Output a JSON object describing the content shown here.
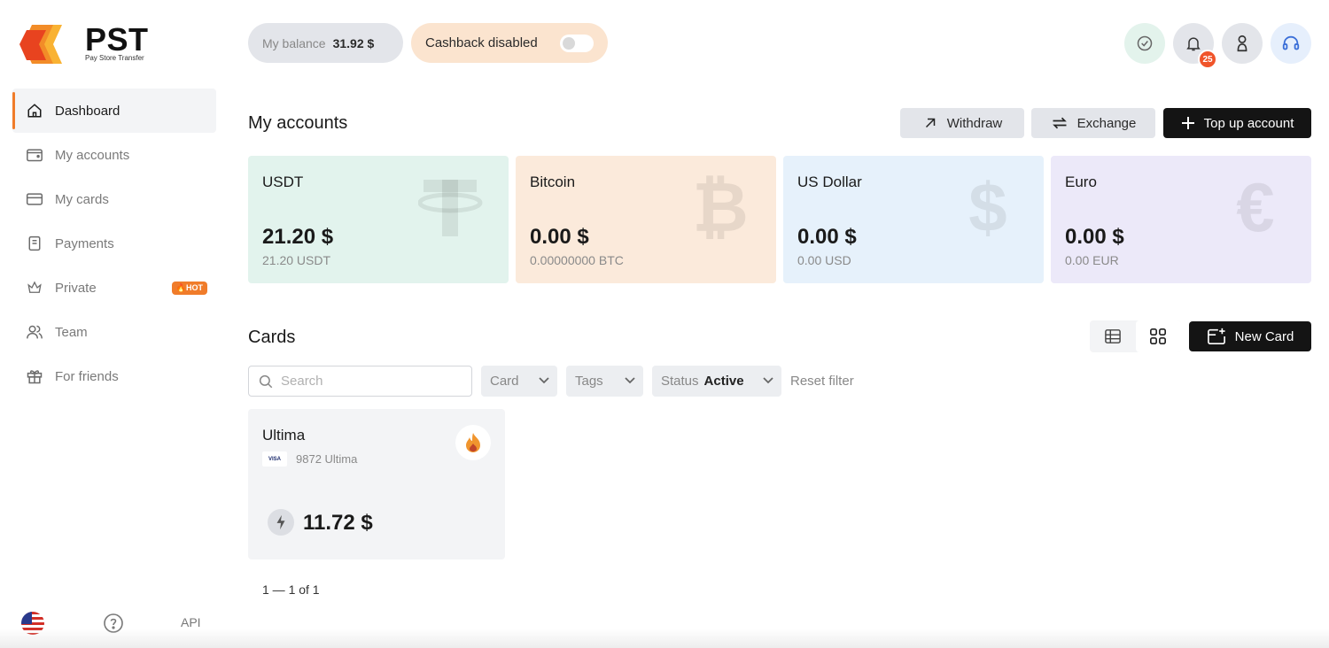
{
  "brand": {
    "name": "PST",
    "tagline": "Pay Store Transfer",
    "accent": "#f07c2a"
  },
  "sidebar": {
    "items": [
      {
        "label": "Dashboard",
        "icon": "home-icon",
        "active": true
      },
      {
        "label": "My accounts",
        "icon": "wallet-icon"
      },
      {
        "label": "My cards",
        "icon": "card-icon"
      },
      {
        "label": "Payments",
        "icon": "receipt-icon"
      },
      {
        "label": "Private",
        "icon": "crown-icon",
        "badge": "HOT"
      },
      {
        "label": "Team",
        "icon": "team-icon"
      },
      {
        "label": "For friends",
        "icon": "gift-icon"
      }
    ],
    "footer": {
      "language_icon": "us-flag-icon",
      "help_icon": "help-icon",
      "api_label": "API"
    }
  },
  "topbar": {
    "balance_label": "My balance",
    "balance_value": "31.92 $",
    "cashback_label": "Cashback disabled",
    "cashback_enabled": false,
    "notifications_count": "25"
  },
  "accounts": {
    "title": "My accounts",
    "actions": {
      "withdraw": "Withdraw",
      "exchange": "Exchange",
      "topup": "Top up account"
    },
    "items": [
      {
        "name": "USDT",
        "amount": "21.20 $",
        "sub": "21.20 USDT",
        "symbol": "T",
        "bg": "#e2f3ed"
      },
      {
        "name": "Bitcoin",
        "amount": "0.00 $",
        "sub": "0.00000000 BTC",
        "symbol": "₿",
        "bg": "#fbeadb"
      },
      {
        "name": "US Dollar",
        "amount": "0.00 $",
        "sub": "0.00 USD",
        "symbol": "$",
        "bg": "#e6f1fb"
      },
      {
        "name": "Euro",
        "amount": "0.00 $",
        "sub": "0.00 EUR",
        "symbol": "€",
        "bg": "#ece9f9"
      }
    ]
  },
  "cards": {
    "title": "Cards",
    "new_card": "New Card",
    "filters": {
      "search_placeholder": "Search",
      "card": "Card",
      "tags": "Tags",
      "status_label": "Status",
      "status_value": "Active",
      "reset": "Reset filter"
    },
    "items": [
      {
        "name": "Ultima",
        "brand": "VISA",
        "number": "9872 Ultima",
        "amount": "11.72 $"
      }
    ],
    "pagination": "1 — 1 of 1"
  }
}
